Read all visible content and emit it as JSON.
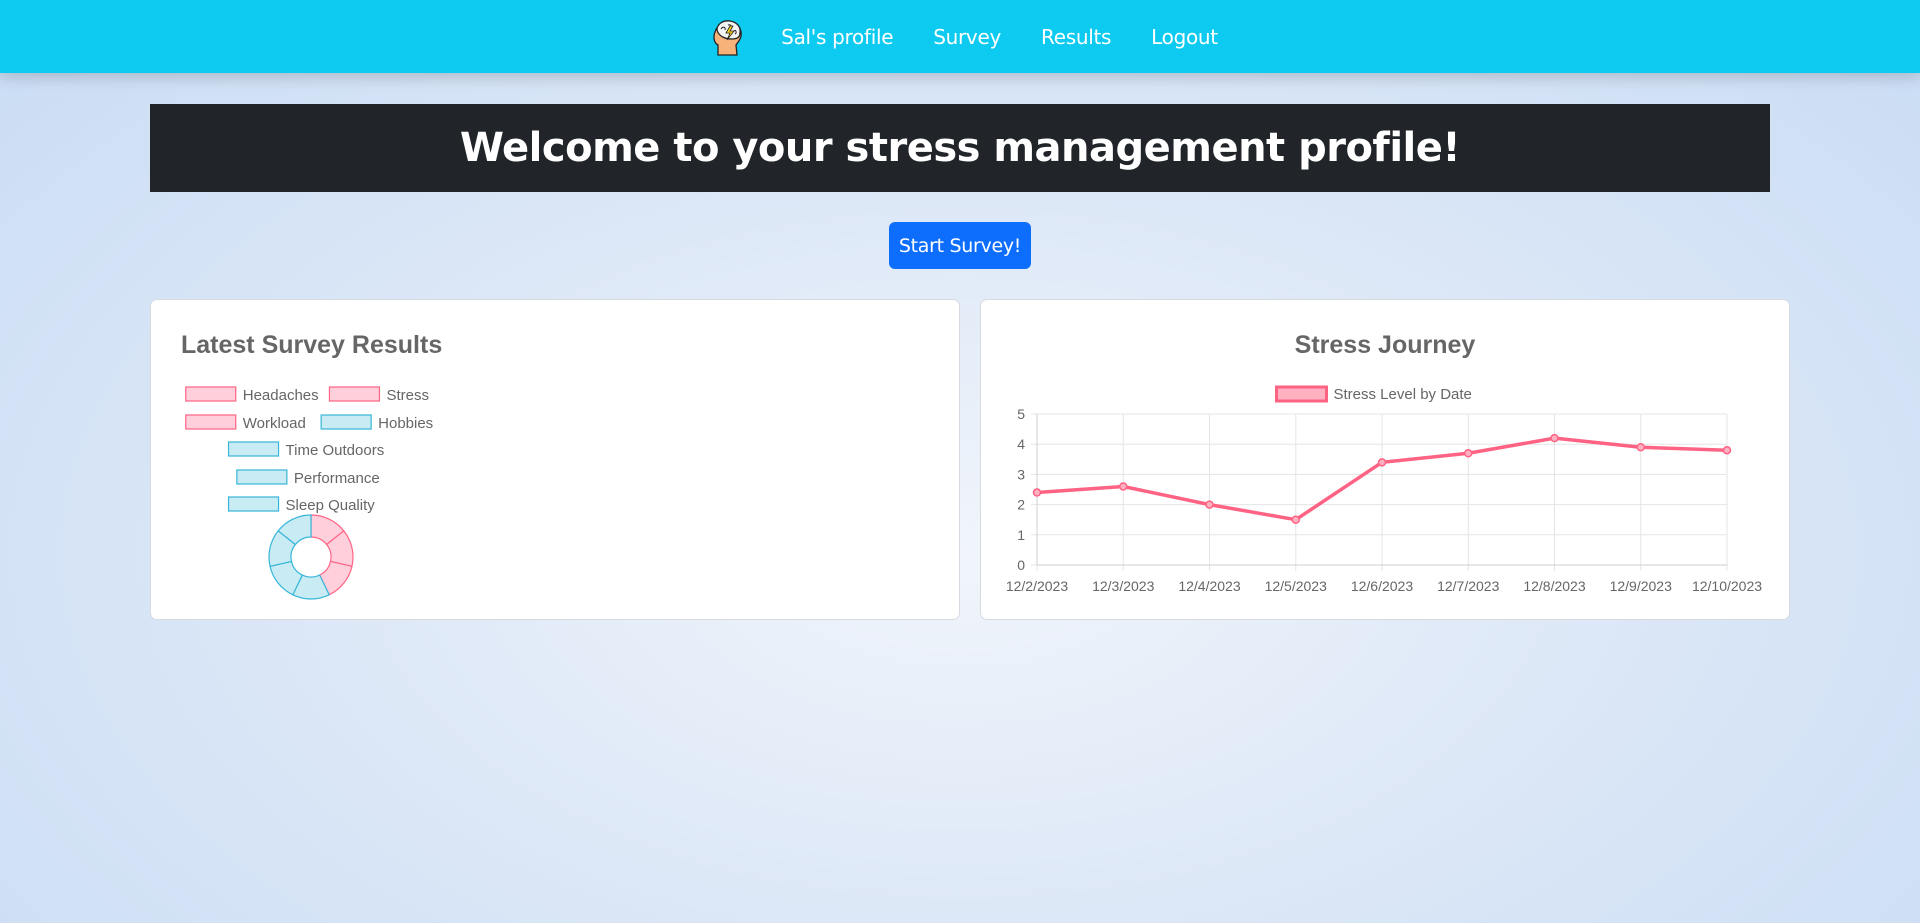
{
  "nav": {
    "links": [
      "Sal's profile",
      "Survey",
      "Results",
      "Logout"
    ]
  },
  "banner": {
    "title": "Welcome to your stress management profile!"
  },
  "actions": {
    "start_survey": "Start Survey!"
  },
  "colors": {
    "navbar": "#0dcaf0",
    "banner": "#212529",
    "primary_button": "#0d6efd",
    "pink": "#ff6384",
    "pink_fill": "#ffd0dc",
    "teal": "#36b6d8",
    "teal_fill": "#c9ecf4"
  },
  "latest_results": {
    "title": "Latest Survey Results",
    "chart_data": {
      "type": "pie",
      "categories": [
        "Headaches",
        "Stress",
        "Workload",
        "Hobbies",
        "Time Outdoors",
        "Performance",
        "Sleep Quality"
      ],
      "values": [
        1,
        1,
        1,
        1,
        1,
        1,
        1
      ],
      "colors": [
        "pink",
        "pink",
        "pink",
        "teal",
        "teal",
        "teal",
        "teal"
      ],
      "legend": "top"
    }
  },
  "stress_journey": {
    "title": "Stress Journey",
    "chart_data": {
      "type": "line",
      "x": [
        "12/2/2023",
        "12/3/2023",
        "12/4/2023",
        "12/5/2023",
        "12/6/2023",
        "12/7/2023",
        "12/8/2023",
        "12/9/2023",
        "12/10/2023"
      ],
      "series": [
        {
          "name": "Stress Level by Date",
          "values": [
            2.4,
            2.6,
            2.0,
            1.5,
            3.4,
            3.7,
            4.2,
            3.9,
            3.8
          ]
        }
      ],
      "ylim": [
        0,
        5
      ],
      "yticks": [
        "0",
        "1",
        "2",
        "3",
        "4",
        "5"
      ],
      "grid": true,
      "legend": "top"
    }
  }
}
